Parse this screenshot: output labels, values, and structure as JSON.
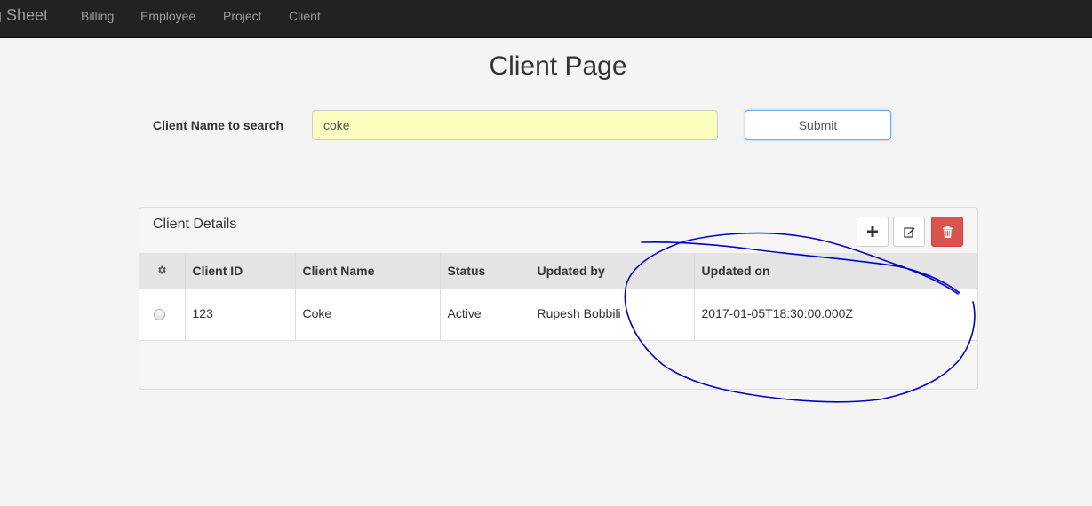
{
  "navbar": {
    "brand": "g Sheet",
    "links": [
      {
        "label": "Billing"
      },
      {
        "label": "Employee"
      },
      {
        "label": "Project"
      },
      {
        "label": "Client"
      }
    ]
  },
  "page": {
    "title": "Client Page"
  },
  "search": {
    "label": "Client Name to search",
    "value": "coke",
    "submit_label": "Submit"
  },
  "panel": {
    "title": "Client Details",
    "toolbar": {
      "add_icon": "plus-icon",
      "edit_icon": "edit-icon",
      "delete_icon": "trash-icon",
      "delete_color": "#d9534f"
    },
    "columns": [
      "Client ID",
      "Client Name",
      "Status",
      "Updated by",
      "Updated on"
    ],
    "settings_icon": "gear-icon",
    "rows": [
      {
        "client_id": "123",
        "client_name": "Coke",
        "status": "Active",
        "updated_by": "Rupesh Bobbili",
        "updated_on": "2017-01-05T18:30:00.000Z"
      }
    ]
  },
  "annotation": {
    "color": "#0000cc"
  }
}
